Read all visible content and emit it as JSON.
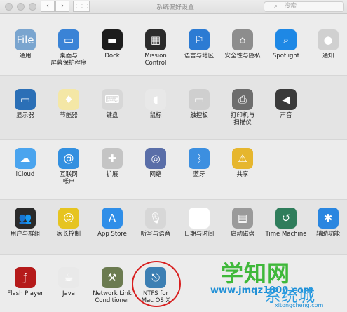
{
  "window": {
    "title": "系统偏好设置"
  },
  "toolbar": {
    "back": "‹",
    "forward": "›",
    "grid": "⋮⋮⋮"
  },
  "search": {
    "placeholder": "搜索"
  },
  "rows": [
    [
      {
        "label": "通用",
        "icon": "general-icon",
        "color": "#7aa5cf",
        "glyph": "File"
      },
      {
        "label": "桌面与\n屏幕保护程序",
        "icon": "desktop-icon",
        "color": "#3a83d6",
        "glyph": "▭"
      },
      {
        "label": "Dock",
        "icon": "dock-icon",
        "color": "#1d1d1d",
        "glyph": "▬"
      },
      {
        "label": "Mission\nControl",
        "icon": "mission-control-icon",
        "color": "#2b2b2b",
        "glyph": "▦"
      },
      {
        "label": "语言与地区",
        "icon": "language-icon",
        "color": "#2c7bd3",
        "glyph": "⚐"
      },
      {
        "label": "安全性与隐私",
        "icon": "lock-icon",
        "color": "#8d8d8d",
        "glyph": "⌂"
      },
      {
        "label": "Spotlight",
        "icon": "spotlight-icon",
        "color": "#1e88e5",
        "glyph": "⌕"
      },
      {
        "label": "通知",
        "icon": "notifications-icon",
        "color": "#d0d0d0",
        "glyph": "●"
      }
    ],
    [
      {
        "label": "显示器",
        "icon": "display-icon",
        "color": "#2b6fb6",
        "glyph": "▭"
      },
      {
        "label": "节能器",
        "icon": "bulb-icon",
        "color": "#f4e7a6",
        "glyph": "♦"
      },
      {
        "label": "键盘",
        "icon": "keyboard-icon",
        "color": "#d7d7d7",
        "glyph": "⌨"
      },
      {
        "label": "鼠标",
        "icon": "mouse-icon",
        "color": "#e8e8e8",
        "glyph": "◖"
      },
      {
        "label": "触控板",
        "icon": "trackpad-icon",
        "color": "#cfcfcf",
        "glyph": "▭"
      },
      {
        "label": "打印机与\n扫描仪",
        "icon": "printer-icon",
        "color": "#6d6d6d",
        "glyph": "⎙"
      },
      {
        "label": "声音",
        "icon": "speaker-icon",
        "color": "#3a3a3a",
        "glyph": "◀"
      }
    ],
    [
      {
        "label": "iCloud",
        "icon": "icloud-icon",
        "color": "#4aa4ee",
        "glyph": "☁"
      },
      {
        "label": "互联网\n帐户",
        "icon": "at-icon",
        "color": "#3390e0",
        "glyph": "@"
      },
      {
        "label": "扩展",
        "icon": "puzzle-icon",
        "color": "#c4c4c4",
        "glyph": "✚"
      },
      {
        "label": "网络",
        "icon": "network-icon",
        "color": "#5a6ea8",
        "glyph": "◎"
      },
      {
        "label": "蓝牙",
        "icon": "bluetooth-icon",
        "color": "#3c8fe0",
        "glyph": "ᛒ"
      },
      {
        "label": "共享",
        "icon": "sharing-icon",
        "color": "#e6b62e",
        "glyph": "⚠"
      }
    ],
    [
      {
        "label": "用户与群组",
        "icon": "users-icon",
        "color": "#2a2a2a",
        "glyph": "👥"
      },
      {
        "label": "家长控制",
        "icon": "parental-icon",
        "color": "#e6c420",
        "glyph": "☺"
      },
      {
        "label": "App Store",
        "icon": "appstore-icon",
        "color": "#2f8ee8",
        "glyph": "A"
      },
      {
        "label": "听写与语音",
        "icon": "microphone-icon",
        "color": "#d7d7d7",
        "glyph": "🎙"
      },
      {
        "label": "日期与时间",
        "icon": "clock-icon",
        "color": "#ffffff",
        "glyph": "◷"
      },
      {
        "label": "启动磁盘",
        "icon": "disk-icon",
        "color": "#9a9a9a",
        "glyph": "▤"
      },
      {
        "label": "Time Machine",
        "icon": "timemachine-icon",
        "color": "#2f7d5b",
        "glyph": "↺"
      },
      {
        "label": "辅助功能",
        "icon": "accessibility-icon",
        "color": "#2a86e0",
        "glyph": "✱"
      }
    ],
    [
      {
        "label": "Flash Player",
        "icon": "flash-icon",
        "color": "#b51a1a",
        "glyph": "ƒ"
      },
      {
        "label": "Java",
        "icon": "java-icon",
        "color": "#e9e9e9",
        "glyph": "☕"
      },
      {
        "label": "Network Link\nConditioner",
        "icon": "network-link-icon",
        "color": "#6b7b50",
        "glyph": "⚒"
      },
      {
        "label": "NTFS for\nMac OS X",
        "icon": "ntfs-icon",
        "color": "#3c7fb3",
        "glyph": "⎋"
      }
    ]
  ],
  "watermark": {
    "main": "学知网",
    "url": "www.jmqz1000.com",
    "brand": "系统城",
    "brand_url": "xitongcheng.com"
  }
}
